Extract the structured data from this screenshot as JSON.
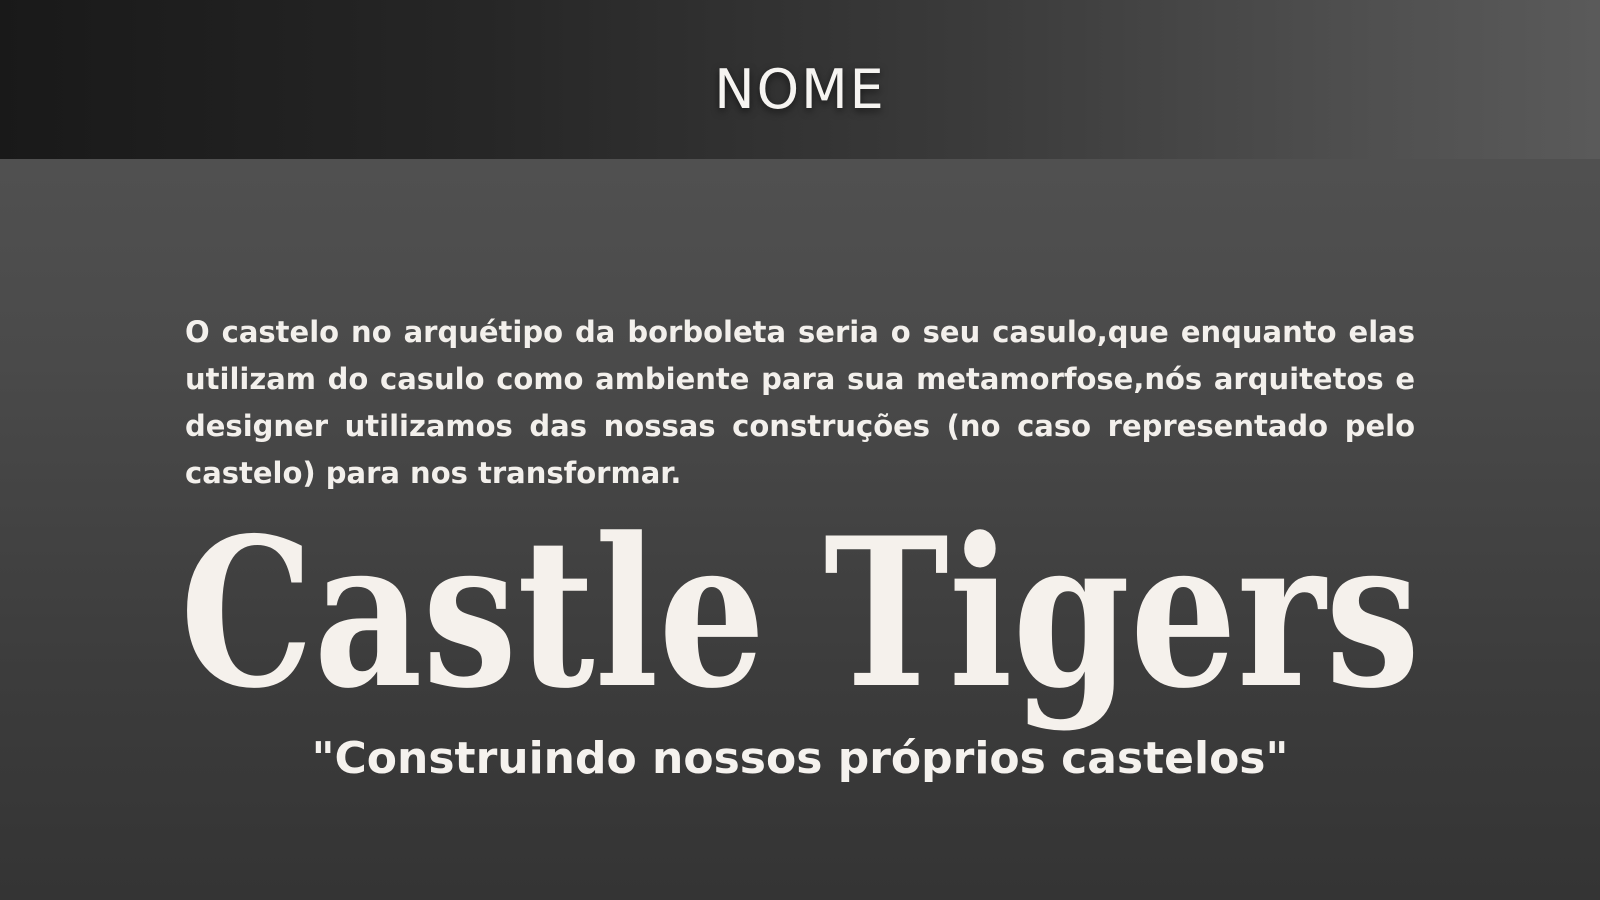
{
  "header": {
    "title": "NOME"
  },
  "content": {
    "description": "O castelo no arquétipo da borboleta seria o seu casulo,que enquanto elas utilizam do casulo como ambiente para sua metamorfose,nós arquitetos e designer utilizamos das nossas construções (no caso representado pelo castelo) para nos transformar.",
    "brand_name": "Castle Tigers",
    "slogan": "\"Construindo nossos próprios castelos\""
  },
  "colors": {
    "background": "#4a4a4a",
    "header_band": "#1c1c1c",
    "text": "#f5f1ec"
  }
}
